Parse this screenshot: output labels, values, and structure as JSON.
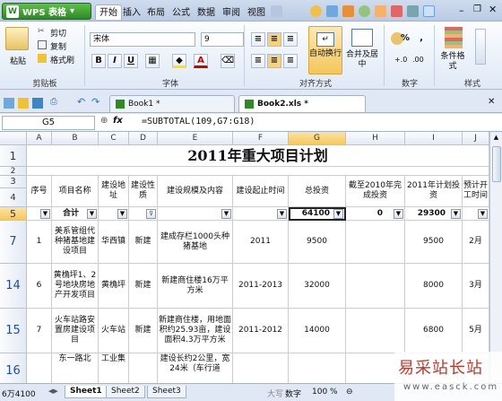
{
  "app": {
    "logo": "W",
    "name": "WPS 表格"
  },
  "menu": [
    "开始",
    "插入",
    "布局",
    "公式",
    "数据",
    "审阅",
    "视图"
  ],
  "ribbon": {
    "paste": "粘贴",
    "cut": "剪切",
    "copy": "复制",
    "format_painter": "格式刷",
    "clipboard_label": "剪贴板",
    "font_name": "宋体",
    "font_size": "9",
    "font_label": "字体",
    "bold": "B",
    "italic": "I",
    "underline": "U",
    "font_color_glyph": "A",
    "wrap": "自动换行",
    "merge": "合并及居中",
    "align_label": "对齐方式",
    "number_label": "数字",
    "percent": "%",
    "comma": ",",
    "cond_format": "条件格式",
    "style_label": "样式"
  },
  "doc_tabs": [
    {
      "name": "Book1 *"
    },
    {
      "name": "Book2.xls *"
    }
  ],
  "formula_bar": {
    "cell_ref": "G5",
    "fx": "fx",
    "formula": "=SUBTOTAL(109,G7:G18)"
  },
  "columns": [
    "A",
    "B",
    "C",
    "D",
    "E",
    "F",
    "G",
    "H",
    "I",
    "J"
  ],
  "rows": {
    "r1": "1",
    "r2": "2",
    "r3": "3",
    "r4": "4",
    "r5": "5",
    "r7": "7",
    "r14": "14",
    "r15": "15",
    "r16": "16"
  },
  "sheet": {
    "title": "2011年重大项目计划",
    "headers": [
      "序号",
      "项目名称",
      "建设地址",
      "建设性质",
      "建设规模及内容",
      "建设起止时间",
      "总投资",
      "截至2010年完成投资",
      "2011年计划投资",
      "预计开工时间"
    ],
    "totals": {
      "label": "合计",
      "g": "64100",
      "h": "0",
      "i": "29300"
    },
    "data_rows": [
      {
        "a": "1",
        "b": "美系管组代种猪基地建设项目",
        "c": "华西镇",
        "d": "新建",
        "e": "建成存栏1000头种猪基地",
        "f": "2011",
        "g": "9500",
        "h": "",
        "i": "9500",
        "j": "2月"
      },
      {
        "a": "6",
        "b": "黄桷坪1、2号地块房地产开发项目",
        "c": "黄桷坪",
        "d": "新建",
        "e": "新建商住楼16万平方米",
        "f": "2011-2013",
        "g": "32000",
        "h": "",
        "i": "8000",
        "j": "3月"
      },
      {
        "a": "7",
        "b": "火车站路安置房建设项目",
        "c": "火车站",
        "d": "新建",
        "e": "新建商住楼，用地面积约25.93亩，建设面积4.3万平方米",
        "f": "2011-2012",
        "g": "14000",
        "h": "",
        "i": "6800",
        "j": "5月"
      },
      {
        "a": "",
        "b": "东一路北",
        "c": "工业集",
        "d": "",
        "e": "建设长约2公里，宽24米（车行道",
        "f": "",
        "g": "",
        "h": "",
        "i": "",
        "j": ""
      }
    ]
  },
  "sheets": [
    "Sheet1",
    "Sheet2",
    "Sheet3"
  ],
  "status": {
    "left": "6万4100",
    "caps": "大写",
    "num": "数字",
    "zoom": "100 %"
  },
  "watermark": {
    "text": "易采站长站",
    "url": "www.easck.com"
  },
  "colors": {
    "accent": "#2e8a23",
    "selected_header": "#f6c85b",
    "watermark": "#c0392b"
  }
}
